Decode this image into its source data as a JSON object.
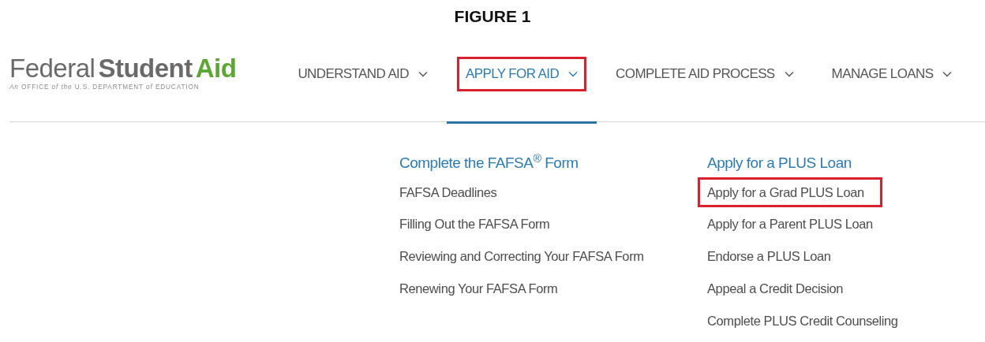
{
  "caption": "FIGURE 1",
  "logo": {
    "parts": [
      {
        "text": "Federal",
        "bold": false
      },
      {
        "text": "Student",
        "bold": true
      },
      {
        "text": "Aid",
        "bold": true,
        "color": "#5aa832"
      }
    ],
    "tagline": "*An* OFFICE *of the* U.S. DEPARTMENT *of* EDUCATION"
  },
  "nav": [
    {
      "label": "UNDERSTAND AID",
      "selected": false,
      "highlighted": false
    },
    {
      "label": "APPLY FOR AID",
      "selected": true,
      "highlighted": true
    },
    {
      "label": "COMPLETE AID PROCESS",
      "selected": false,
      "highlighted": false
    },
    {
      "label": "MANAGE LOANS",
      "selected": false,
      "highlighted": false
    }
  ],
  "menu_columns": [
    {
      "heading": "Complete the FAFSA$^{®}$ Form",
      "links": [
        {
          "label": "FAFSA Deadlines",
          "highlighted": false
        },
        {
          "label": "Filling Out the FAFSA Form",
          "highlighted": false
        },
        {
          "label": "Reviewing and Correcting Your FAFSA Form",
          "highlighted": false
        },
        {
          "label": "Renewing Your FAFSA Form",
          "highlighted": false
        }
      ]
    },
    {
      "heading": "Apply for a PLUS Loan",
      "links": [
        {
          "label": "Apply for a Grad PLUS Loan",
          "highlighted": true
        },
        {
          "label": "Apply for a Parent PLUS Loan",
          "highlighted": false
        },
        {
          "label": "Endorse a PLUS Loan",
          "highlighted": false
        },
        {
          "label": "Appeal a Credit Decision",
          "highlighted": false
        },
        {
          "label": "Complete PLUS Credit Counseling",
          "highlighted": false
        }
      ]
    }
  ]
}
